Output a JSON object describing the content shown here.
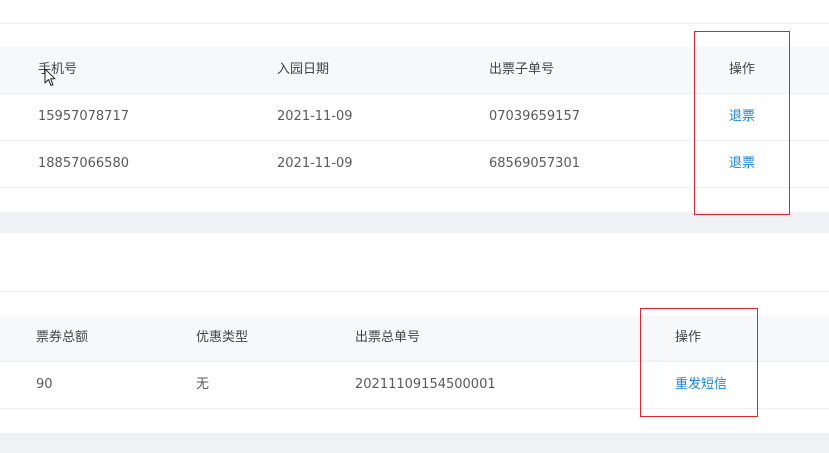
{
  "table1": {
    "headers": {
      "phone": "手机号",
      "date": "入园日期",
      "sub_order": "出票子单号",
      "action": "操作"
    },
    "rows": [
      {
        "phone": "15957078717",
        "date": "2021-11-09",
        "sub_order": "07039659157",
        "action": "退票"
      },
      {
        "phone": "18857066580",
        "date": "2021-11-09",
        "sub_order": "68569057301",
        "action": "退票"
      }
    ]
  },
  "table2": {
    "headers": {
      "total": "票券总额",
      "discount": "优惠类型",
      "order": "出票总单号",
      "action": "操作"
    },
    "rows": [
      {
        "total": "90",
        "discount": "无",
        "order": "20211109154500001",
        "action": "重发短信"
      }
    ]
  },
  "colors": {
    "link": "#1b85d8",
    "highlight_box": "#d9262b",
    "header_bg": "#f7f8fa",
    "section_gap": "#f0f1f4"
  },
  "icons": [
    "mouse-cursor-icon"
  ]
}
